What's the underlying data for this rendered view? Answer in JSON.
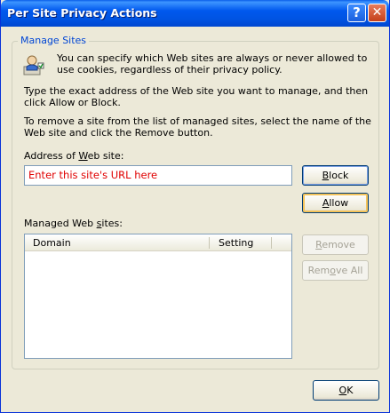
{
  "window": {
    "title": "Per Site Privacy Actions",
    "help_glyph": "?",
    "close_glyph": "✕"
  },
  "group": {
    "legend": "Manage Sites",
    "intro": "You can specify which Web sites are always or never allowed to use cookies, regardless of their privacy policy.",
    "instruction_1": "Type the exact address of the Web site you want to manage, and then click Allow or Block.",
    "instruction_2": "To remove a site from the list of managed sites, select the name of the Web site and click the Remove button."
  },
  "address": {
    "label_pre": "Address of ",
    "label_key": "W",
    "label_post": "eb site:",
    "value": "Enter this site's URL here"
  },
  "buttons": {
    "block_key": "B",
    "block_rest": "lock",
    "allow_key": "A",
    "allow_rest": "llow",
    "remove_key": "R",
    "remove_rest": "emove",
    "removeall_pre": "Rem",
    "removeall_key": "o",
    "removeall_post": "ve All",
    "ok_key": "O",
    "ok_rest": "K"
  },
  "managed": {
    "label_pre": "Managed Web ",
    "label_key": "s",
    "label_post": "ites:",
    "columns": [
      "Domain",
      "Setting"
    ],
    "rows": []
  },
  "colors": {
    "title_bar": "#0054e3",
    "legend_text": "#0046d5",
    "url_text": "#e00000",
    "dialog_bg": "#ece9d8"
  }
}
